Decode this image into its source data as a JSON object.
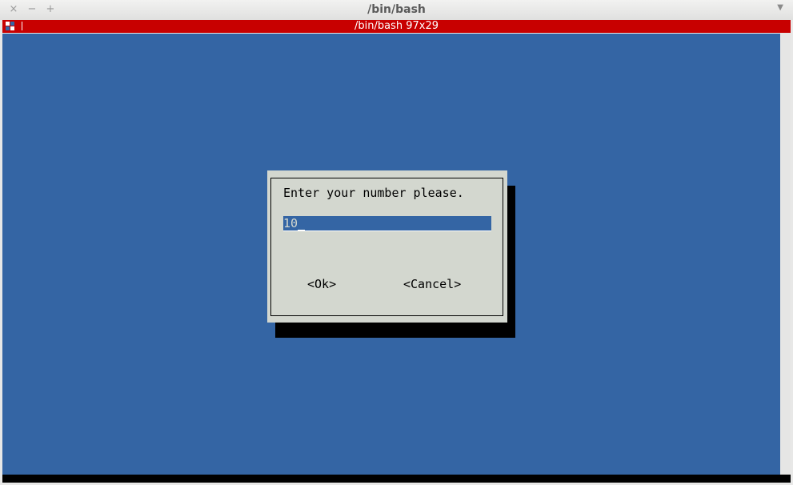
{
  "window": {
    "title": "/bin/bash",
    "close_glyph": "×",
    "minimize_glyph": "−",
    "maximize_glyph": "+",
    "menu_glyph": "▼"
  },
  "tab": {
    "title": "/bin/bash 97x29"
  },
  "colors": {
    "terminal_bg": "#3465a4",
    "tab_bar": "#c80000",
    "dialog_bg": "#d3d7cf",
    "shadow": "#000000"
  },
  "dialog": {
    "prompt": "Enter your number please.",
    "input_value": "10",
    "ok_label": "<Ok>",
    "cancel_label": "<Cancel>"
  }
}
